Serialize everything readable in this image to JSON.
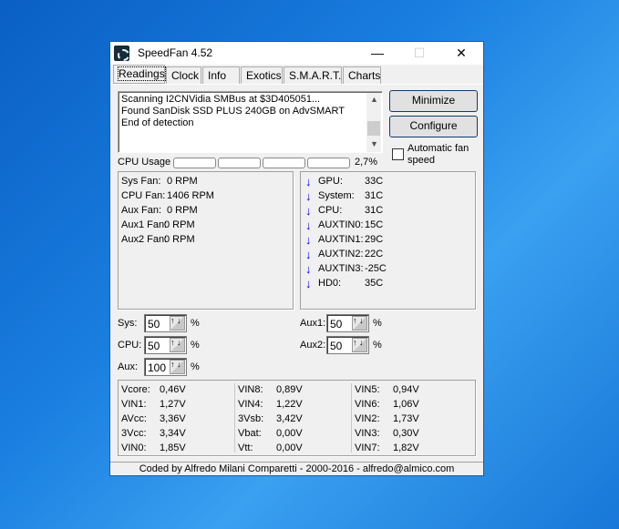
{
  "window": {
    "title": "SpeedFan 4.52",
    "minimize": "—",
    "maximize": "☐",
    "close": "✕"
  },
  "tabs": [
    "Readings",
    "Clock",
    "Info",
    "Exotics",
    "S.M.A.R.T.",
    "Charts"
  ],
  "log": [
    "Scanning I2CNVidia SMBus at $3D405051...",
    "Found SanDisk SSD PLUS 240GB on AdvSMART",
    "End of detection"
  ],
  "buttons": {
    "minimize": "Minimize",
    "configure": "Configure"
  },
  "auto_fan": {
    "label": "Automatic fan speed",
    "checked": false
  },
  "cpu_usage": {
    "label": "CPU Usage",
    "value": "2,7%"
  },
  "fans": [
    {
      "label": "Sys Fan:",
      "value": "0 RPM"
    },
    {
      "label": "CPU Fan:",
      "value": "1406 RPM"
    },
    {
      "label": "Aux Fan:",
      "value": "0 RPM"
    },
    {
      "label": "Aux1 Fan:",
      "value": "0 RPM"
    },
    {
      "label": "Aux2 Fan:",
      "value": "0 RPM"
    }
  ],
  "temps": [
    {
      "label": "GPU:",
      "value": "33C"
    },
    {
      "label": "System:",
      "value": "31C"
    },
    {
      "label": "CPU:",
      "value": "31C"
    },
    {
      "label": "AUXTIN0:",
      "value": "15C"
    },
    {
      "label": "AUXTIN1:",
      "value": "29C"
    },
    {
      "label": "AUXTIN2:",
      "value": "22C"
    },
    {
      "label": "AUXTIN3:",
      "value": "-25C"
    },
    {
      "label": "HD0:",
      "value": "35C"
    }
  ],
  "speeds": [
    {
      "label": "Sys:",
      "value": "50"
    },
    {
      "label": "CPU:",
      "value": "50"
    },
    {
      "label": "Aux:",
      "value": "100"
    },
    {
      "label": "Aux1:",
      "value": "50"
    },
    {
      "label": "Aux2:",
      "value": "50"
    }
  ],
  "percent": "%",
  "voltages": [
    [
      {
        "label": "Vcore:",
        "value": "0,46V"
      },
      {
        "label": "VIN1:",
        "value": "1,27V"
      },
      {
        "label": "AVcc:",
        "value": "3,36V"
      },
      {
        "label": "3Vcc:",
        "value": "3,34V"
      },
      {
        "label": "VIN0:",
        "value": "1,85V"
      }
    ],
    [
      {
        "label": "VIN8:",
        "value": "0,89V"
      },
      {
        "label": "VIN4:",
        "value": "1,22V"
      },
      {
        "label": "3Vsb:",
        "value": "3,42V"
      },
      {
        "label": "Vbat:",
        "value": "0,00V"
      },
      {
        "label": "Vtt:",
        "value": "0,00V"
      }
    ],
    [
      {
        "label": "VIN5:",
        "value": "0,94V"
      },
      {
        "label": "VIN6:",
        "value": "1,06V"
      },
      {
        "label": "VIN2:",
        "value": "1,73V"
      },
      {
        "label": "VIN3:",
        "value": "0,30V"
      },
      {
        "label": "VIN7:",
        "value": "1,82V"
      }
    ]
  ],
  "footer": "Coded by Alfredo Milani Comparetti - 2000-2016 - alfredo@almico.com"
}
